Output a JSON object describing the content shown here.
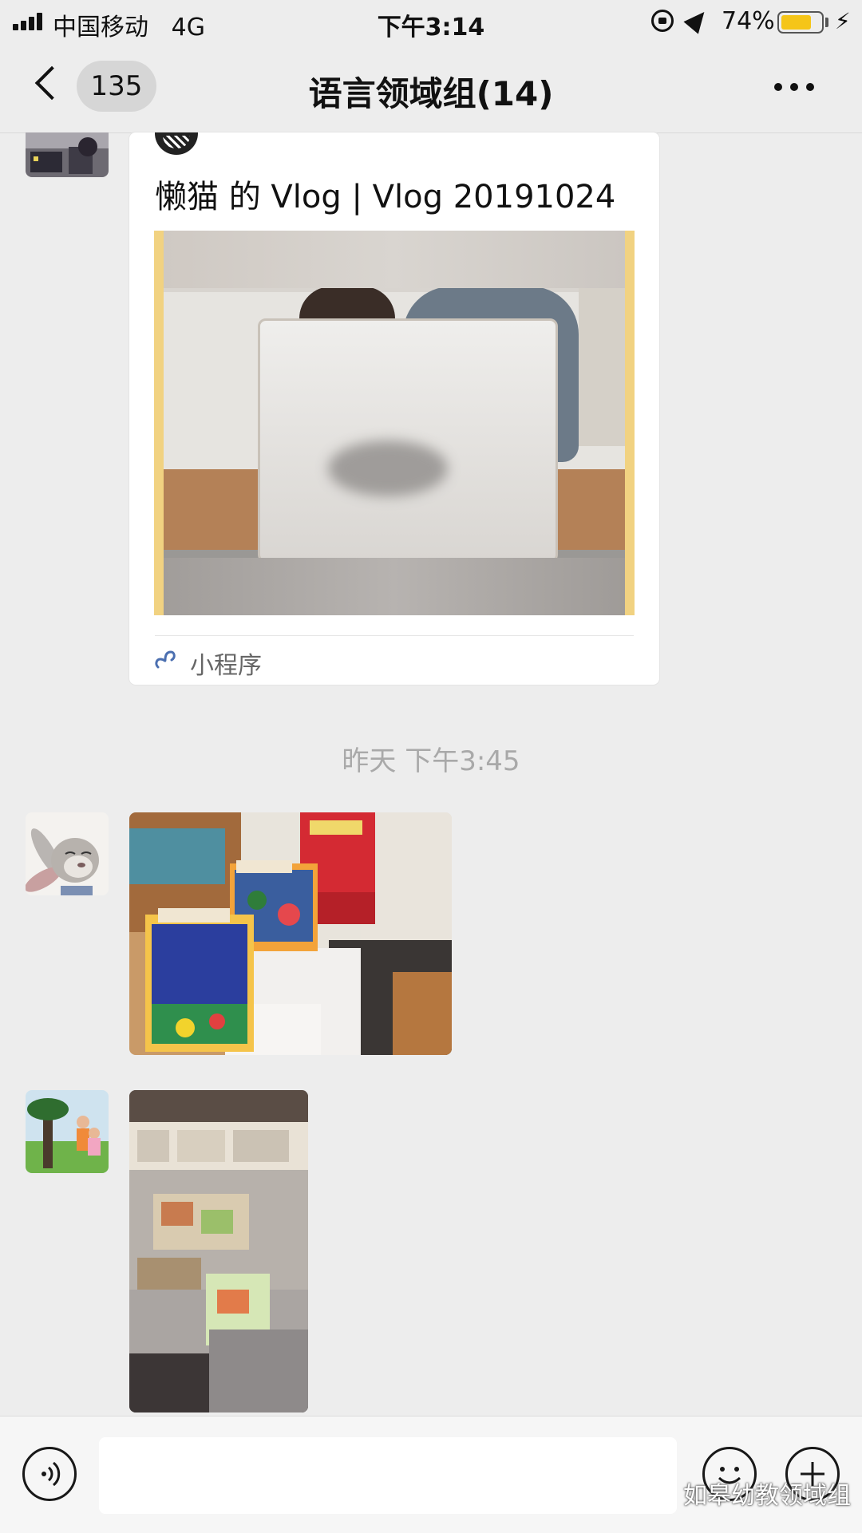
{
  "status_bar": {
    "carrier": "中国移动",
    "network": "4G",
    "time": "下午3:14",
    "battery_percent_text": "74%",
    "battery_level": 0.74,
    "battery_color": "#f5c518"
  },
  "nav": {
    "back_icon": "chevron-left-icon",
    "unread_count": "135",
    "title": "语言领域组(14)",
    "more_icon": "more-icon"
  },
  "messages": {
    "mini_program_card": {
      "title": "懒猫 的 Vlog | Vlog 20191024",
      "source_label": "小程序",
      "source_icon": "mini-program-icon"
    },
    "timestamp": "昨天 下午3:45"
  },
  "input_bar": {
    "voice_icon": "voice-icon",
    "emoji_icon": "emoji-icon",
    "plus_icon": "plus-icon",
    "text_value": ""
  },
  "watermark": {
    "text": "如皋幼教领域组",
    "icon": "wechat-icon"
  }
}
